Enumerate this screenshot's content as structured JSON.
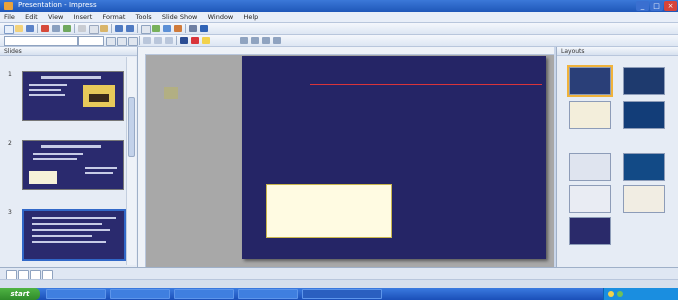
{
  "window": {
    "title": "Presentation - Impress",
    "app_icon": "impress-app-icon"
  },
  "menu": [
    "File",
    "Edit",
    "View",
    "Insert",
    "Format",
    "Tools",
    "Slide Show",
    "Window",
    "Help"
  ],
  "toolbar2": {
    "font_name": "",
    "font_size": ""
  },
  "slides_pane": {
    "header": "Slides",
    "numbers": [
      "1",
      "2",
      "3"
    ]
  },
  "slide": {
    "title": "",
    "bullets": [
      "",
      "",
      "",
      ""
    ],
    "right_lines": [
      "",
      "",
      "",
      "",
      "",
      ""
    ],
    "note_lines": [
      "",
      "",
      "",
      ""
    ]
  },
  "task_pane": {
    "header": "Layouts",
    "section": ""
  },
  "viewbar": {
    "zoom": ""
  },
  "statusbar": {
    "slide": "",
    "layout": ""
  },
  "taskbar": {
    "start_label": "start",
    "apps": [
      "",
      "",
      "",
      "",
      ""
    ],
    "clock": ""
  },
  "colors": {
    "slide_bg": "#252566",
    "title_bar": "#1f57b8",
    "taskbar": "#1a4fb8",
    "note_bg": "#fffbe2",
    "accent_red": "#d9343a"
  }
}
